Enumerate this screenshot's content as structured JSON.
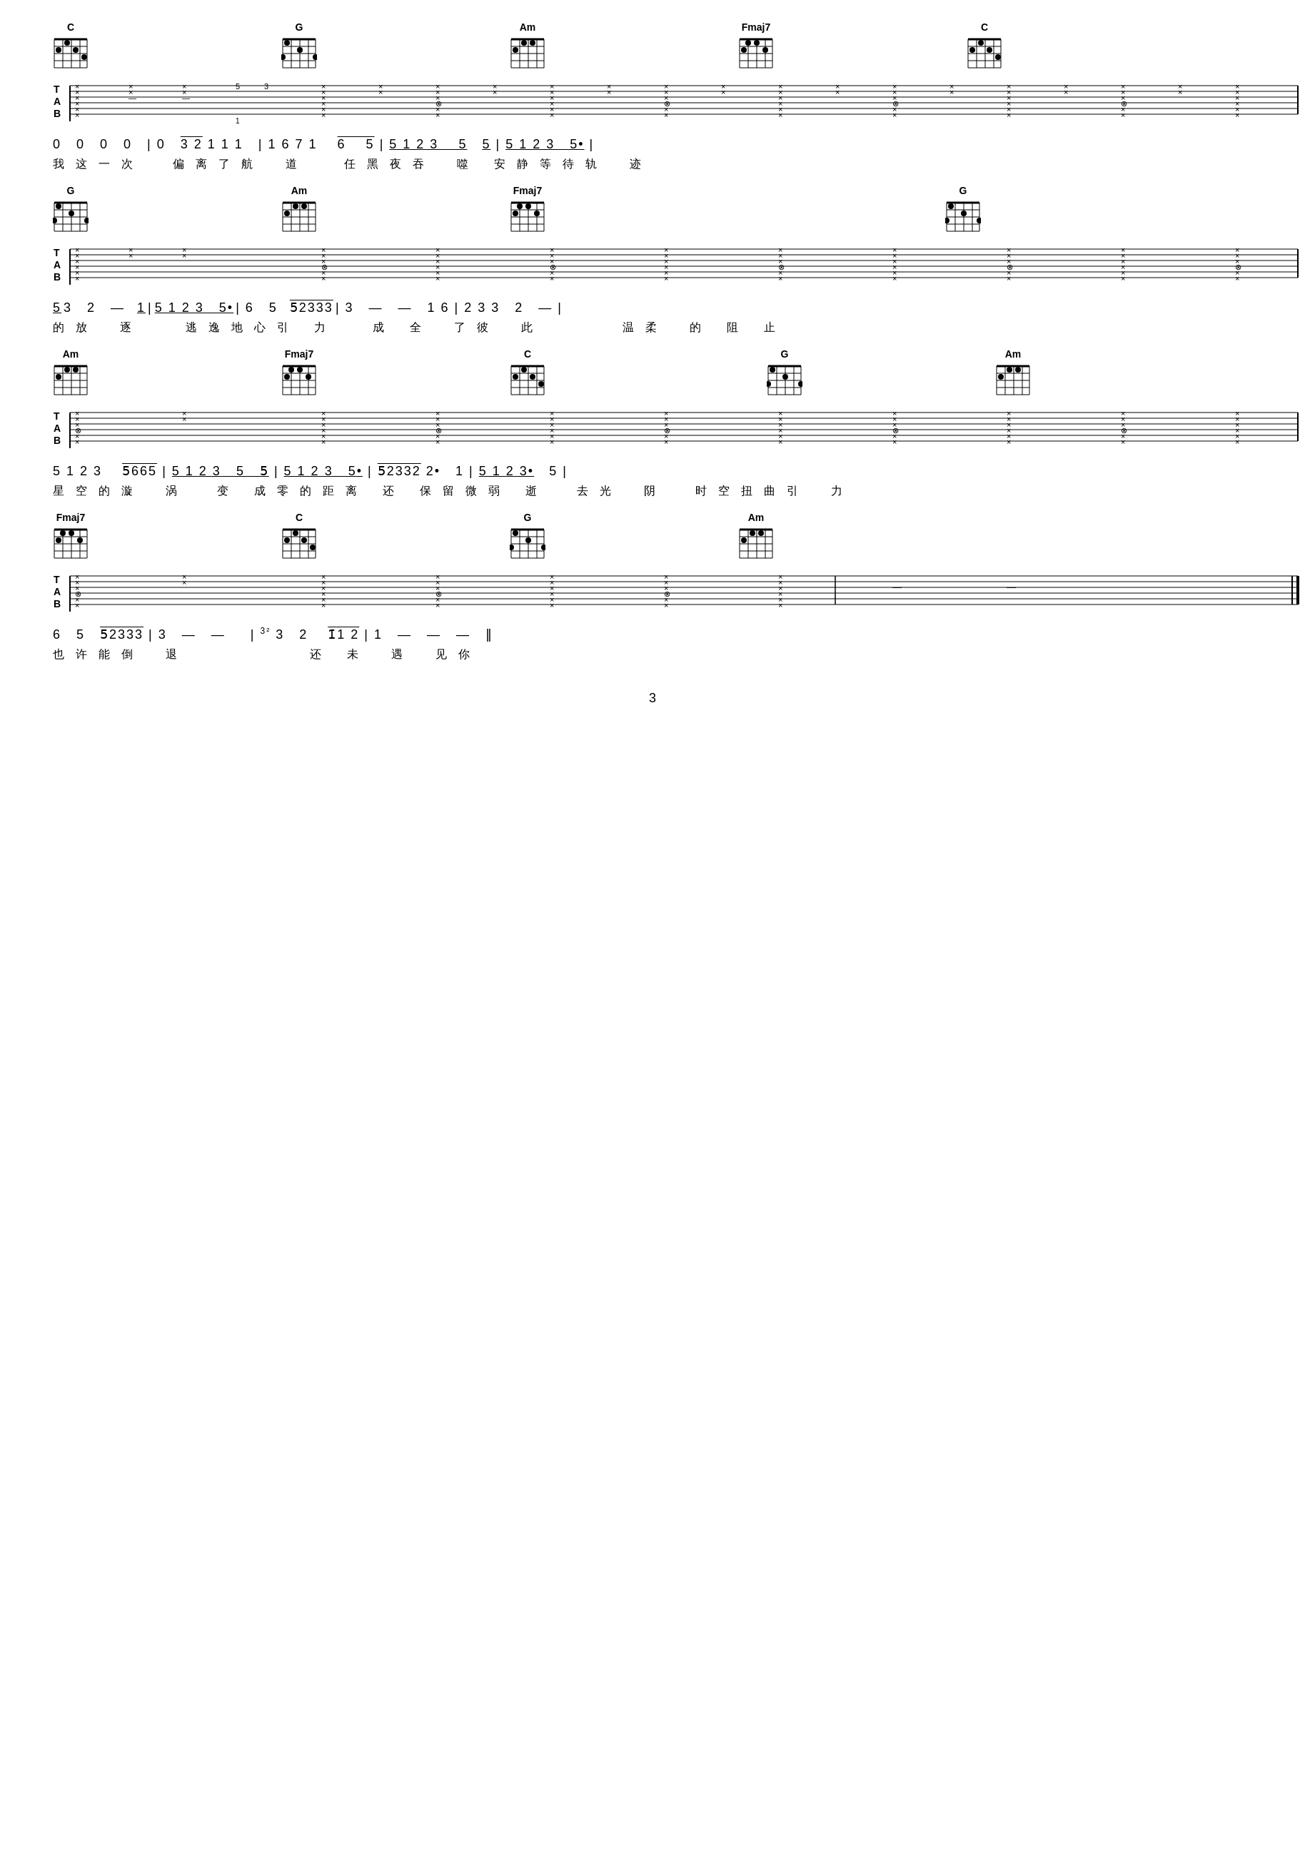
{
  "page": {
    "number": "3",
    "sections": [
      {
        "id": "section1",
        "chords": [
          {
            "name": "C",
            "position": 60
          },
          {
            "name": "G",
            "position": 370
          },
          {
            "name": "Am",
            "position": 680
          },
          {
            "name": "Fmaj7",
            "position": 990
          },
          {
            "name": "C",
            "position": 1360
          }
        ],
        "notation": "0  0  0  0  | 0   3 2 1 1 1  | 1 6 7 1   6   5̄ | 5 1 2 3   5   5̄ | 5 1 2 3  5•  |",
        "lyrics": "我 这 一 次        偏 离 了 航   道      任 黑 夜 吞   噬  安 静 等 待 轨   迹"
      },
      {
        "id": "section2",
        "chords": [
          {
            "name": "G",
            "position": 60
          },
          {
            "name": "Am",
            "position": 370
          },
          {
            "name": "Fmaj7",
            "position": 680
          },
          {
            "name": "G",
            "position": 1230
          }
        ],
        "notation": "5̄ 3  2  —  1̄ | 5 1 2 3  5•  | 6  5  5̄2333 | 3  —  —  1 6 | 2 3 3  2  —  |",
        "lyrics": "的 放   逐       逃 逸 地 心 引  力     成  全   了 彼   此            温 柔   的  阻  止"
      },
      {
        "id": "section3",
        "chords": [
          {
            "name": "Am",
            "position": 60
          },
          {
            "name": "Fmaj7",
            "position": 370
          },
          {
            "name": "C",
            "position": 680
          },
          {
            "name": "G",
            "position": 1050
          },
          {
            "name": "Am",
            "position": 1360
          }
        ],
        "notation": "5 1 2 3   5̄665 | 5 1 2 3  5  5̄ | 5 1 2 3  5•   | 5̄2332 2•  1 | 5 1 2 3•  5  |",
        "lyrics": "星 空 的 漩   涡      变  成 零 的 距 离  还  保 留 微 弱  逝      去 光   阴     时 空 扭 曲 引   力"
      },
      {
        "id": "section4",
        "chords": [
          {
            "name": "Fmaj7",
            "position": 60
          },
          {
            "name": "C",
            "position": 370
          },
          {
            "name": "G",
            "position": 680
          },
          {
            "name": "Am",
            "position": 1050
          }
        ],
        "notation": "6  5  5̄2333 | 3  —  —       | 3² 3  2   1̄12 | 1  —  —  —  ‖",
        "lyrics": "也 许 能 倒   退                     还  未   遇   见 你"
      }
    ]
  }
}
